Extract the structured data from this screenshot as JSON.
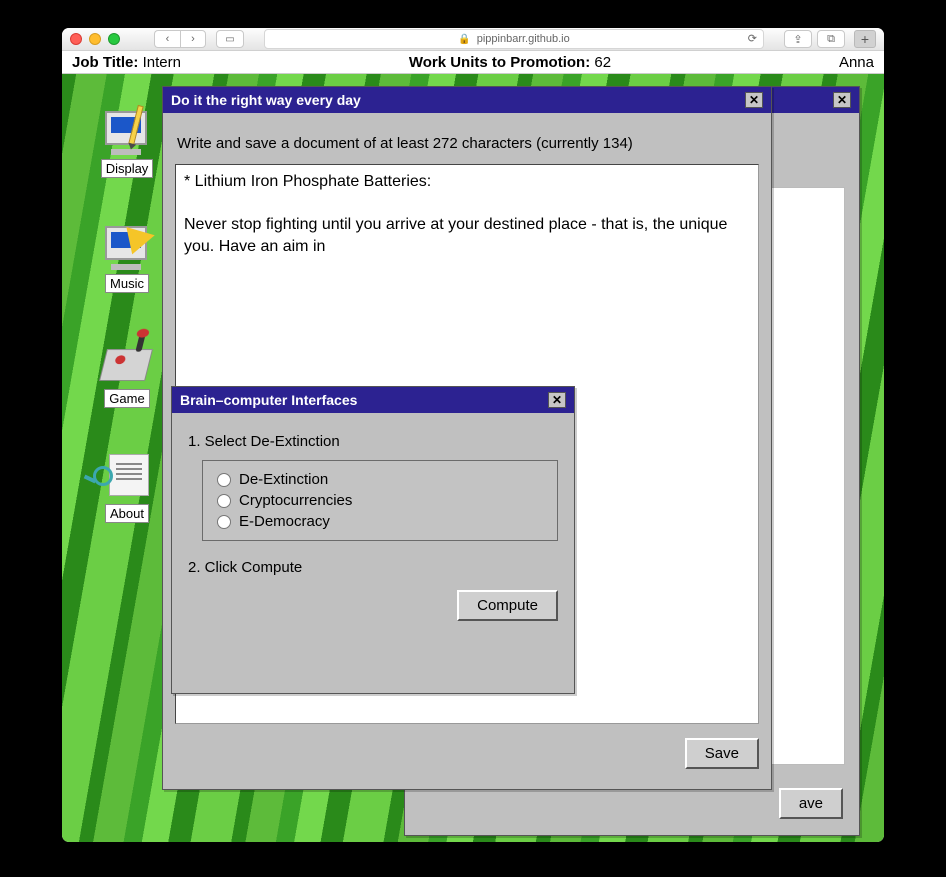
{
  "browser": {
    "url": "pippinbarr.github.io"
  },
  "status": {
    "job_title_label": "Job Title:",
    "job_title_value": "Intern",
    "promotion_label": "Work Units to Promotion:",
    "promotion_value": "62",
    "username": "Anna"
  },
  "desktop_icons": [
    {
      "label": "Display"
    },
    {
      "label": "Music"
    },
    {
      "label": "Game"
    },
    {
      "label": "About"
    }
  ],
  "background_window": {
    "save_label": "ave"
  },
  "main_window": {
    "title": "Do it the right way every day",
    "instruction": "Write and save a document of at least 272 characters (currently 134)",
    "document_text": "* Lithium Iron Phosphate Batteries:\n\nNever stop fighting until you arrive at your destined place - that is, the unique you. Have an aim in",
    "save_label": "Save"
  },
  "brain_window": {
    "title": "Brain–computer Interfaces",
    "step1": "1. Select De-Extinction",
    "options": [
      "De-Extinction",
      "Cryptocurrencies",
      "E-Democracy"
    ],
    "step2": "2. Click Compute",
    "compute_label": "Compute"
  }
}
